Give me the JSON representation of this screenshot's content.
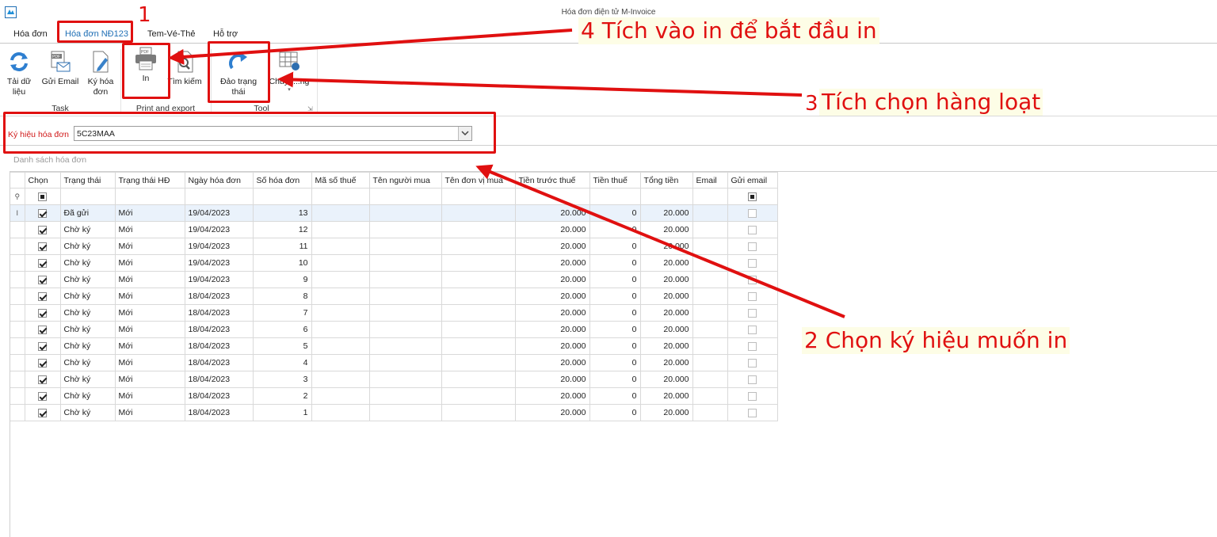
{
  "window": {
    "title": "Hóa đơn điện tử M-Invoice"
  },
  "ribbon_tabs": [
    "Hóa đơn",
    "Hóa đơn NĐ123",
    "Tem-Vé-Thẻ",
    "Hỗ trợ"
  ],
  "ribbon": {
    "task": {
      "label": "Task",
      "reload": "Tải dữ\nliệu",
      "send_email": "Gửi Email",
      "sign": "Ký hóa\nđơn"
    },
    "print": {
      "label": "Print and export",
      "print": "In",
      "search": "Tìm kiếm"
    },
    "tool": {
      "label": "Tool",
      "toggle_status": "Đảo trạng\nthái",
      "convert": "Chuyể...ng"
    }
  },
  "filter": {
    "label": "Ký hiệu hóa đơn",
    "value": "5C23MAA"
  },
  "list_caption": "Danh sách hóa đơn",
  "columns": [
    "Chọn",
    "Trạng thái",
    "Trạng thái HĐ",
    "Ngày hóa đơn",
    "Số hóa đơn",
    "Mã số thuế",
    "Tên người mua",
    "Tên đơn vị mua",
    "Tiền trước thuế",
    "Tiền thuế",
    "Tổng tiền",
    "Email",
    "Gửi email"
  ],
  "rows": [
    {
      "status": "Đã gửi",
      "inv_status": "Mới",
      "date": "19/04/2023",
      "number": "13",
      "pretax": "20.000",
      "tax": "0",
      "total": "20.000"
    },
    {
      "status": "Chờ ký",
      "inv_status": "Mới",
      "date": "19/04/2023",
      "number": "12",
      "pretax": "20.000",
      "tax": "0",
      "total": "20.000"
    },
    {
      "status": "Chờ ký",
      "inv_status": "Mới",
      "date": "19/04/2023",
      "number": "11",
      "pretax": "20.000",
      "tax": "0",
      "total": "20.000"
    },
    {
      "status": "Chờ ký",
      "inv_status": "Mới",
      "date": "19/04/2023",
      "number": "10",
      "pretax": "20.000",
      "tax": "0",
      "total": "20.000"
    },
    {
      "status": "Chờ ký",
      "inv_status": "Mới",
      "date": "19/04/2023",
      "number": "9",
      "pretax": "20.000",
      "tax": "0",
      "total": "20.000"
    },
    {
      "status": "Chờ ký",
      "inv_status": "Mới",
      "date": "18/04/2023",
      "number": "8",
      "pretax": "20.000",
      "tax": "0",
      "total": "20.000"
    },
    {
      "status": "Chờ ký",
      "inv_status": "Mới",
      "date": "18/04/2023",
      "number": "7",
      "pretax": "20.000",
      "tax": "0",
      "total": "20.000"
    },
    {
      "status": "Chờ ký",
      "inv_status": "Mới",
      "date": "18/04/2023",
      "number": "6",
      "pretax": "20.000",
      "tax": "0",
      "total": "20.000"
    },
    {
      "status": "Chờ ký",
      "inv_status": "Mới",
      "date": "18/04/2023",
      "number": "5",
      "pretax": "20.000",
      "tax": "0",
      "total": "20.000"
    },
    {
      "status": "Chờ ký",
      "inv_status": "Mới",
      "date": "18/04/2023",
      "number": "4",
      "pretax": "20.000",
      "tax": "0",
      "total": "20.000"
    },
    {
      "status": "Chờ ký",
      "inv_status": "Mới",
      "date": "18/04/2023",
      "number": "3",
      "pretax": "20.000",
      "tax": "0",
      "total": "20.000"
    },
    {
      "status": "Chờ ký",
      "inv_status": "Mới",
      "date": "18/04/2023",
      "number": "2",
      "pretax": "20.000",
      "tax": "0",
      "total": "20.000"
    },
    {
      "status": "Chờ ký",
      "inv_status": "Mới",
      "date": "18/04/2023",
      "number": "1",
      "pretax": "20.000",
      "tax": "0",
      "total": "20.000"
    }
  ],
  "annotations": {
    "step1": "1",
    "step2": "2 Chọn ký hiệu muốn in",
    "step3_num": "3",
    "step3": "Tích chọn hàng loạt",
    "step4": "4 Tích vào in để bắt đầu in"
  },
  "colors": {
    "annotation": "#e01010",
    "active_tab": "#1f6fb5",
    "filter_label": "#d11a1a"
  }
}
